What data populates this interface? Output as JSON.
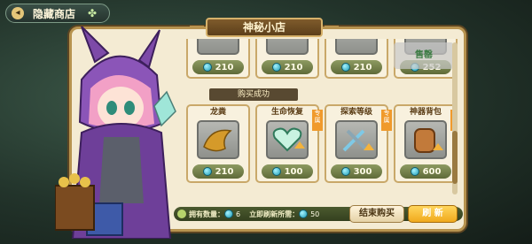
{
  "header": {
    "title": "隐藏商店"
  },
  "shop": {
    "title": "神秘小店",
    "toast": "购买成功",
    "sold_label": "售罄"
  },
  "items_top": [
    {
      "price": "210"
    },
    {
      "price": "210"
    },
    {
      "price": "210"
    },
    {
      "price": "252"
    }
  ],
  "items": [
    {
      "name": "龙粪",
      "price": "210",
      "ribbon": "",
      "icon": "dragon-dung-icon"
    },
    {
      "name": "生命恢复",
      "price": "100",
      "ribbon": "专属",
      "icon": "heart-upgrade-icon"
    },
    {
      "name": "探索等级",
      "price": "300",
      "ribbon": "专属",
      "icon": "tools-upgrade-icon"
    },
    {
      "name": "神器背包",
      "price": "600",
      "ribbon": "专属",
      "icon": "backpack-upgrade-icon"
    }
  ],
  "footer": {
    "owned_label": "拥有数量：",
    "owned_value": "6",
    "refresh_cost_label": "立即刷新所需：",
    "refresh_cost_value": "50",
    "end_button": "结束购买",
    "refresh_button": "刷 新"
  },
  "colors": {
    "gold": "#d6b16a",
    "accent": "#f0a91d",
    "panel": "#f4ebd3"
  }
}
